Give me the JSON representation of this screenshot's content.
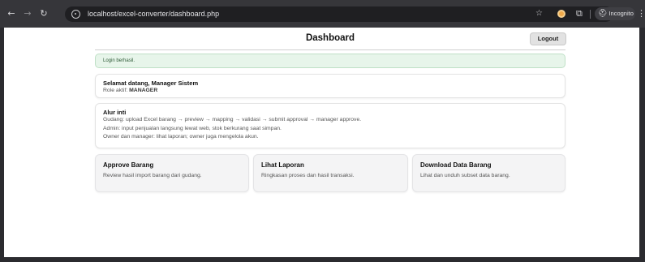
{
  "browser": {
    "url": "localhost/excel-converter/dashboard.php",
    "incognito_label": "Incognito",
    "icons": [
      "back-arrow-icon",
      "forward-arrow-icon",
      "reload-icon",
      "site-info-icon",
      "bookmark-star-icon",
      "extension-icon",
      "puzzle-icon",
      "incognito-icon",
      "menu-dots-icon"
    ]
  },
  "header": {
    "title": "Dashboard",
    "logout_label": "Logout"
  },
  "alert": {
    "text": "Login berhasil."
  },
  "welcome": {
    "greeting": "Selamat datang, Manager Sistem",
    "role_prefix": "Role aktif:",
    "role_value": "MANAGER"
  },
  "flow": {
    "title": "Alur inti",
    "lines": [
      "Gudang: upload Excel barang → preview → mapping → validasi → submit approval → manager approve.",
      "Admin: input penjualan langsung lewat web, stok berkurang saat simpan.",
      "Owner dan manager: lihat laporan; owner juga mengelola akun."
    ]
  },
  "menu_boxes": [
    {
      "title": "Approve Barang",
      "description": "Review hasil import barang dari gudang."
    },
    {
      "title": "Lihat Laporan",
      "description": "Ringkasan proses dan hasil transaksi."
    },
    {
      "title": "Download Data Barang",
      "description": "Lihat dan unduh subset data barang."
    }
  ],
  "colors": {
    "alert_bg": "#e7f5ea",
    "alert_border": "#bfe0c6",
    "box_bg": "#f4f4f5",
    "chrome_bg": "#36363a"
  }
}
